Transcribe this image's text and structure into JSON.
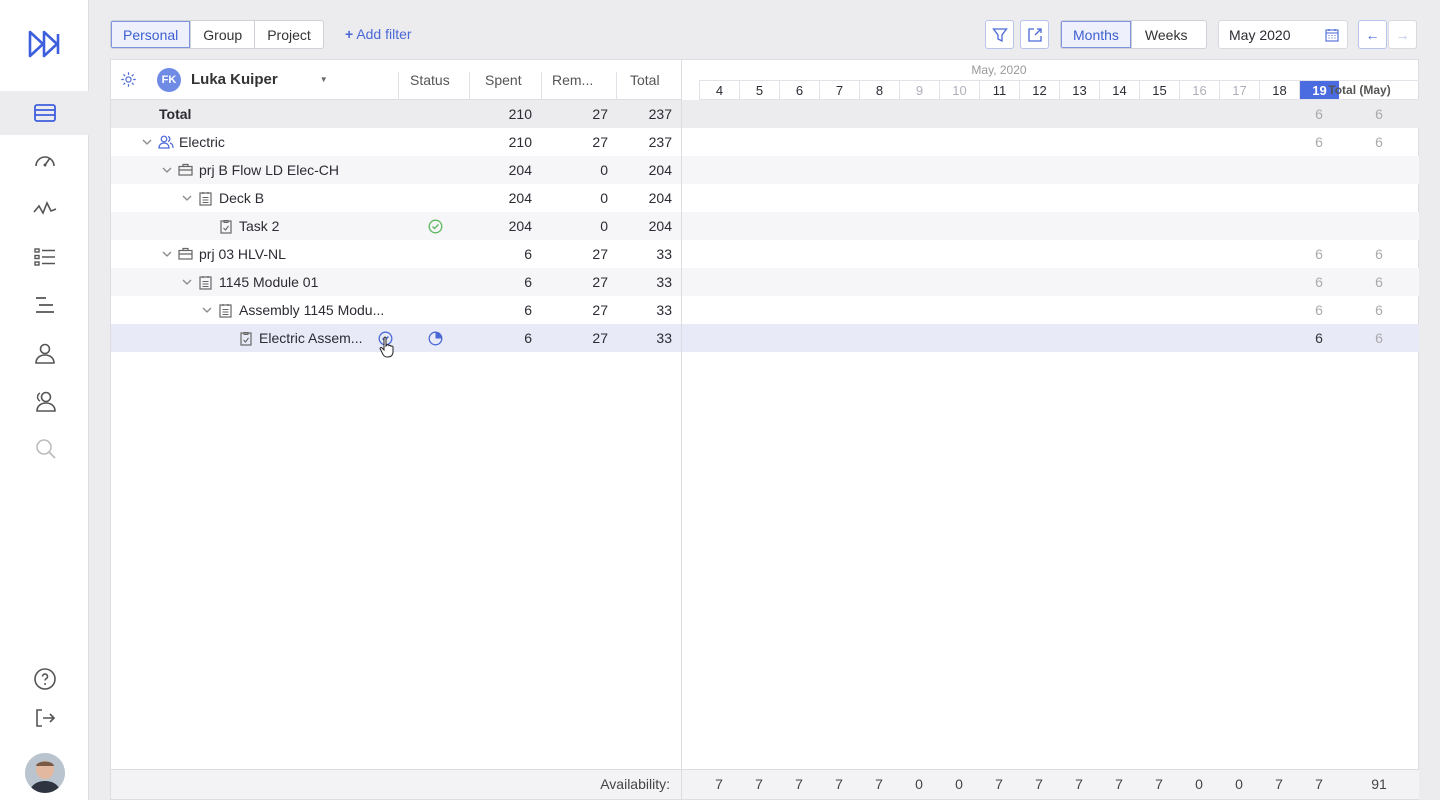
{
  "toolbar": {
    "views": [
      "Personal",
      "Group",
      "Project"
    ],
    "add_filter": "Add filter",
    "scales": [
      "Months",
      "Weeks"
    ],
    "date": "May 2020",
    "prev": "←",
    "next": "→"
  },
  "grid": {
    "user_initials": "FK",
    "user_name": "Luka Kuiper",
    "headers": {
      "status": "Status",
      "spent": "Spent",
      "rem": "Rem...",
      "total": "Total"
    },
    "rows": [
      {
        "name": "Total",
        "spent": "210",
        "rem": "27",
        "total": "237"
      },
      {
        "name": "Electric",
        "spent": "210",
        "rem": "27",
        "total": "237"
      },
      {
        "name": "prj B Flow LD Elec-CH",
        "spent": "204",
        "rem": "0",
        "total": "204"
      },
      {
        "name": "Deck B",
        "spent": "204",
        "rem": "0",
        "total": "204"
      },
      {
        "name": "Task 2",
        "spent": "204",
        "rem": "0",
        "total": "204"
      },
      {
        "name": "prj 03 HLV-NL",
        "spent": "6",
        "rem": "27",
        "total": "33"
      },
      {
        "name": "1145 Module 01",
        "spent": "6",
        "rem": "27",
        "total": "33"
      },
      {
        "name": "Assembly 1145 Modu...",
        "spent": "6",
        "rem": "27",
        "total": "33"
      },
      {
        "name": "Electric Assem...",
        "spent": "6",
        "rem": "27",
        "total": "33"
      }
    ],
    "availability_label": "Availability:"
  },
  "calendar": {
    "month": "May, 2020",
    "days": [
      "4",
      "5",
      "6",
      "7",
      "8",
      "9",
      "10",
      "11",
      "12",
      "13",
      "14",
      "15",
      "16",
      "17",
      "18",
      "19"
    ],
    "total_header": "Total (May)",
    "row_values": [
      {
        "day19": "6",
        "total": "6"
      },
      {
        "day19": "6",
        "total": "6"
      },
      {
        "day19": "",
        "total": ""
      },
      {
        "day19": "",
        "total": ""
      },
      {
        "day19": "",
        "total": ""
      },
      {
        "day19": "6",
        "total": "6"
      },
      {
        "day19": "6",
        "total": "6"
      },
      {
        "day19": "6",
        "total": "6"
      },
      {
        "day19": "6",
        "total": "6"
      }
    ],
    "availability": [
      "7",
      "7",
      "7",
      "7",
      "7",
      "0",
      "0",
      "7",
      "7",
      "7",
      "7",
      "7",
      "0",
      "0",
      "7",
      "7"
    ],
    "availability_total": "91"
  },
  "colors": {
    "accent": "#4a6ce0",
    "ok": "#5cb85c"
  }
}
